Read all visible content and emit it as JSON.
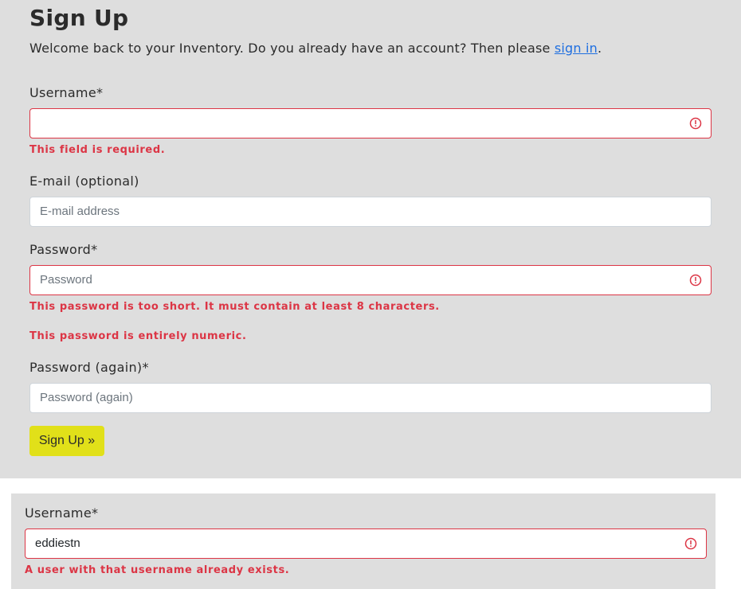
{
  "signup": {
    "title": "Sign Up",
    "welcome_text": "Welcome back to your Inventory. Do you already have an account? Then please ",
    "signin_link": "sign in",
    "welcome_end": ".",
    "username": {
      "label": "Username*",
      "value": "",
      "error": "This field is required."
    },
    "email": {
      "label": "E-mail (optional)",
      "placeholder": "E-mail address"
    },
    "password": {
      "label": "Password*",
      "placeholder": "Password",
      "errors": [
        "This password is too short. It must contain at least 8 characters.",
        "This password is entirely numeric."
      ]
    },
    "password_again": {
      "label": "Password (again)*",
      "placeholder": "Password (again)"
    },
    "submit_label": "Sign Up »"
  },
  "username_taken": {
    "label": "Username*",
    "value": "eddiestn",
    "error": "A user with that username already exists."
  },
  "colors": {
    "panel": "#dedede",
    "error": "#dc3545",
    "button": "#e1e019",
    "link": "#1f6fe0"
  }
}
